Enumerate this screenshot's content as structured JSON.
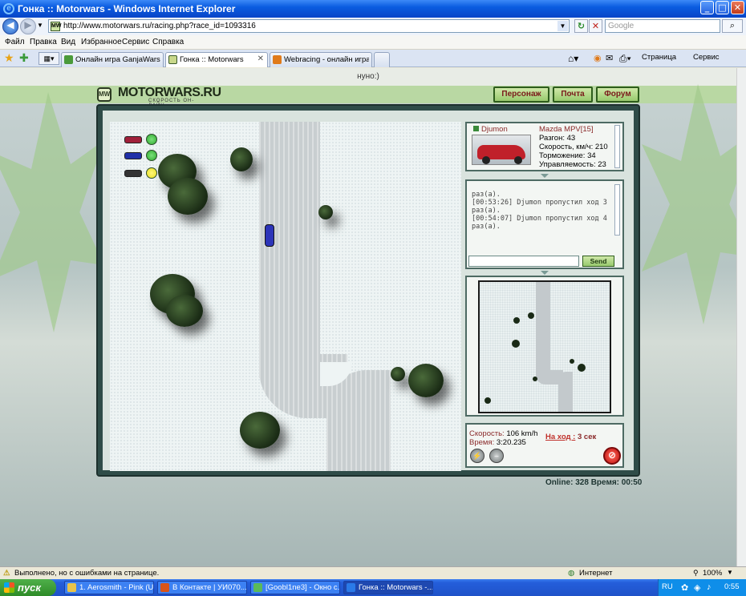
{
  "window": {
    "title": "Гонка :: Motorwars - Windows Internet Explorer",
    "min_glyph": "_",
    "max_glyph": "□",
    "close_glyph": "✕"
  },
  "address": {
    "url": "http://www.motorwars.ru/racing.php?race_id=1093316",
    "search_placeholder": "Google"
  },
  "menu": [
    "Файл",
    "Правка",
    "Вид",
    "Избранное",
    "Сервис",
    "Справка"
  ],
  "tabs": [
    {
      "label": "Онлайн игра GanjaWars.Ru ...",
      "active": false,
      "icon_color": "#4a9a3a"
    },
    {
      "label": "Гонка :: Motorwars",
      "active": true,
      "icon_color": "#c9d88a"
    },
    {
      "label": "Webracing - онлайн игра го...",
      "active": false,
      "icon_color": "#e07a1a"
    }
  ],
  "tab_close_glyph": "✕",
  "toolbar_right": {
    "page": "Страница",
    "tools": "Сервис"
  },
  "page": {
    "top_message": "нуно:)",
    "logo": "MOTORWARS.RU",
    "logo_sub": "СКОРОСТЬ ОН-ЛАЙН",
    "nav": [
      "Персонаж",
      "Почта",
      "Форум"
    ]
  },
  "car_info": {
    "player": "Djumon",
    "model": "Mazda MPV[15]",
    "stats": [
      "Разгон: 43",
      "Скорость, км/ч: 210",
      "Торможение: 34",
      "Управляемость: 23"
    ]
  },
  "chat": {
    "lines": [
      "раз(а).",
      "[00:53:26] Djumon пропустил ход 3",
      "раз(а).",
      "[00:54:07] Djumon пропустил ход 4",
      "раз(а)."
    ],
    "input_value": "",
    "send_label": "Send"
  },
  "race_status": {
    "speed_label": "Скорость:",
    "speed_value": "106 km/h",
    "time_label": "Время:",
    "time_value": "3:20.235",
    "turn_label": "На ход :",
    "turn_value": "3 сек"
  },
  "players": [
    {
      "car_color": "#a0203a",
      "light_color": "#2eaa2e"
    },
    {
      "car_color": "#2030a8",
      "light_color": "#2eaa2e"
    },
    {
      "car_color": "#333333",
      "light_color": "#e8e020"
    }
  ],
  "footer": {
    "online": "Online: 328",
    "time": "Время: 00:50"
  },
  "statusbar": {
    "message": "Выполнено, но с ошибками на странице.",
    "zone": "Интернет",
    "zoom": "100%"
  },
  "taskbar": {
    "start": "пуск",
    "tasks": [
      {
        "label": "1. Aerosmith - Pink (U...",
        "active": false
      },
      {
        "label": "В Контакте | УИ070...",
        "active": false
      },
      {
        "label": "[Goobl1ne3] - Окно с...",
        "active": false
      },
      {
        "label": "Гонка :: Motorwars -...",
        "active": true
      }
    ],
    "lang": "RU",
    "clock": "0:55"
  }
}
